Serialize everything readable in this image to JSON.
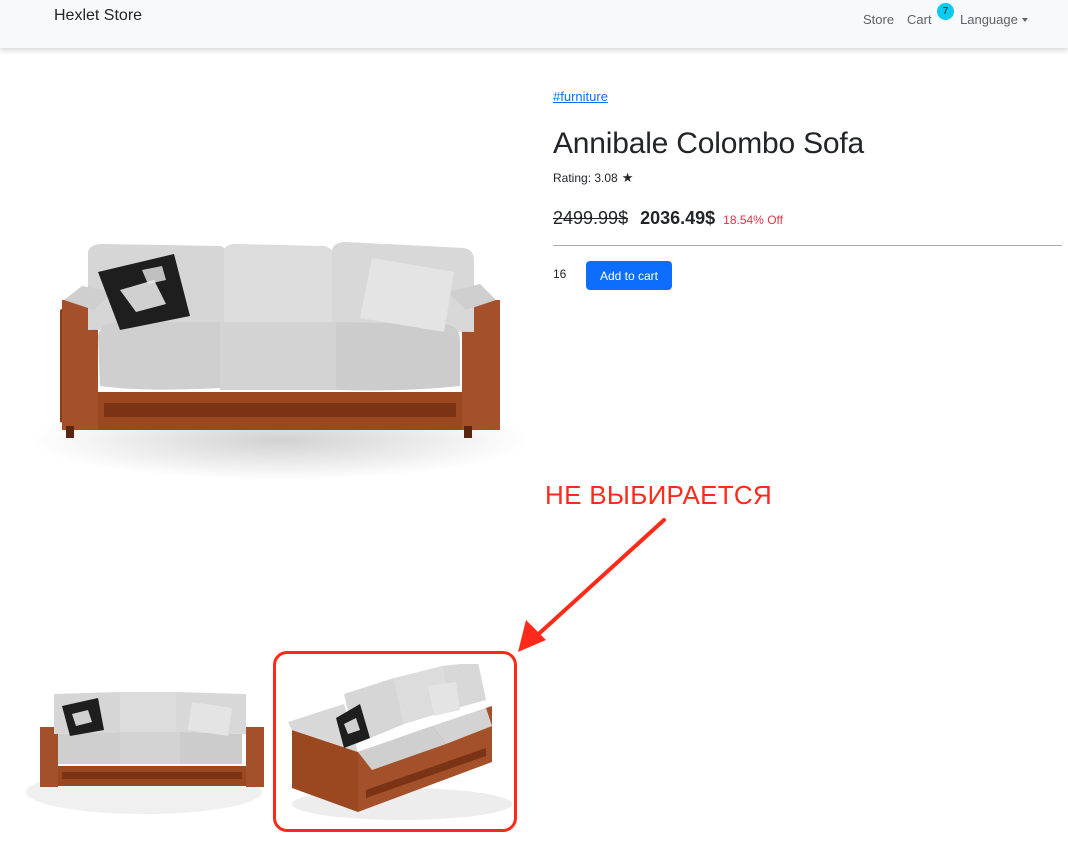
{
  "navbar": {
    "brand": "Hexlet Store",
    "store_label": "Store",
    "cart_label": "Cart",
    "cart_count": "7",
    "language_label": "Language"
  },
  "product": {
    "category_link": "#furniture",
    "title": "Annibale Colombo Sofa",
    "rating_text": "Rating: 3.08",
    "old_price": "2499.99$",
    "new_price": "2036.49$",
    "discount": "18.54% Off",
    "quantity": "16",
    "add_to_cart_label": "Add to cart"
  },
  "annotation": {
    "text": "НЕ ВЫБИРАЕТСЯ"
  },
  "colors": {
    "primary": "#0d6efd",
    "badge": "#0dcaf0",
    "discount": "#dc3545",
    "annotation": "#ff2a1a"
  },
  "icons": {
    "rating": "star-icon",
    "language": "caret-down-icon"
  }
}
